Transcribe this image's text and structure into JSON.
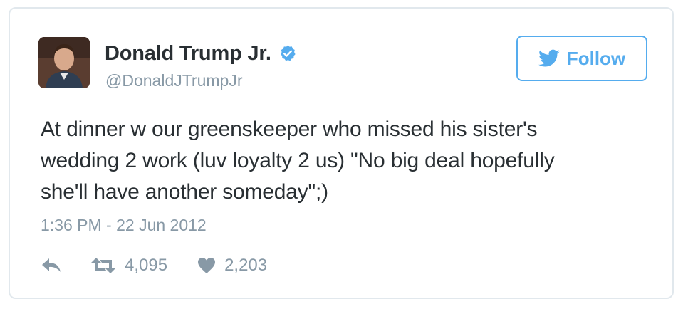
{
  "user": {
    "display_name": "Donald Trump Jr.",
    "handle": "@DonaldJTrumpJr",
    "verified": true
  },
  "follow_button": {
    "label": "Follow"
  },
  "tweet": {
    "text_lines": [
      "At dinner w our greenskeeper who missed his sister's",
      "wedding 2 work (luv loyalty 2 us) \"No big deal hopefully",
      "she'll have another someday\";)"
    ],
    "timestamp": "1:36 PM - 22 Jun 2012"
  },
  "stats": {
    "retweets": "4,095",
    "likes": "2,203"
  },
  "colors": {
    "accent": "#55acee",
    "text": "#292f33",
    "muted": "#8899a6",
    "border": "#e1e8ed"
  },
  "icons": {
    "verified": "verified-badge-icon",
    "bird": "twitter-bird-icon",
    "reply": "reply-icon",
    "retweet": "retweet-icon",
    "like": "heart-icon"
  }
}
